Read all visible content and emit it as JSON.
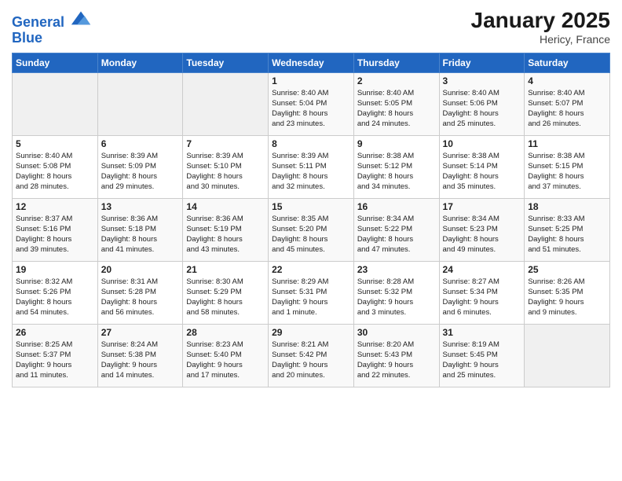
{
  "header": {
    "logo_line1": "General",
    "logo_line2": "Blue",
    "month_title": "January 2025",
    "location": "Hericy, France"
  },
  "weekdays": [
    "Sunday",
    "Monday",
    "Tuesday",
    "Wednesday",
    "Thursday",
    "Friday",
    "Saturday"
  ],
  "weeks": [
    [
      {
        "day": "",
        "info": ""
      },
      {
        "day": "",
        "info": ""
      },
      {
        "day": "",
        "info": ""
      },
      {
        "day": "1",
        "info": "Sunrise: 8:40 AM\nSunset: 5:04 PM\nDaylight: 8 hours\nand 23 minutes."
      },
      {
        "day": "2",
        "info": "Sunrise: 8:40 AM\nSunset: 5:05 PM\nDaylight: 8 hours\nand 24 minutes."
      },
      {
        "day": "3",
        "info": "Sunrise: 8:40 AM\nSunset: 5:06 PM\nDaylight: 8 hours\nand 25 minutes."
      },
      {
        "day": "4",
        "info": "Sunrise: 8:40 AM\nSunset: 5:07 PM\nDaylight: 8 hours\nand 26 minutes."
      }
    ],
    [
      {
        "day": "5",
        "info": "Sunrise: 8:40 AM\nSunset: 5:08 PM\nDaylight: 8 hours\nand 28 minutes."
      },
      {
        "day": "6",
        "info": "Sunrise: 8:39 AM\nSunset: 5:09 PM\nDaylight: 8 hours\nand 29 minutes."
      },
      {
        "day": "7",
        "info": "Sunrise: 8:39 AM\nSunset: 5:10 PM\nDaylight: 8 hours\nand 30 minutes."
      },
      {
        "day": "8",
        "info": "Sunrise: 8:39 AM\nSunset: 5:11 PM\nDaylight: 8 hours\nand 32 minutes."
      },
      {
        "day": "9",
        "info": "Sunrise: 8:38 AM\nSunset: 5:12 PM\nDaylight: 8 hours\nand 34 minutes."
      },
      {
        "day": "10",
        "info": "Sunrise: 8:38 AM\nSunset: 5:14 PM\nDaylight: 8 hours\nand 35 minutes."
      },
      {
        "day": "11",
        "info": "Sunrise: 8:38 AM\nSunset: 5:15 PM\nDaylight: 8 hours\nand 37 minutes."
      }
    ],
    [
      {
        "day": "12",
        "info": "Sunrise: 8:37 AM\nSunset: 5:16 PM\nDaylight: 8 hours\nand 39 minutes."
      },
      {
        "day": "13",
        "info": "Sunrise: 8:36 AM\nSunset: 5:18 PM\nDaylight: 8 hours\nand 41 minutes."
      },
      {
        "day": "14",
        "info": "Sunrise: 8:36 AM\nSunset: 5:19 PM\nDaylight: 8 hours\nand 43 minutes."
      },
      {
        "day": "15",
        "info": "Sunrise: 8:35 AM\nSunset: 5:20 PM\nDaylight: 8 hours\nand 45 minutes."
      },
      {
        "day": "16",
        "info": "Sunrise: 8:34 AM\nSunset: 5:22 PM\nDaylight: 8 hours\nand 47 minutes."
      },
      {
        "day": "17",
        "info": "Sunrise: 8:34 AM\nSunset: 5:23 PM\nDaylight: 8 hours\nand 49 minutes."
      },
      {
        "day": "18",
        "info": "Sunrise: 8:33 AM\nSunset: 5:25 PM\nDaylight: 8 hours\nand 51 minutes."
      }
    ],
    [
      {
        "day": "19",
        "info": "Sunrise: 8:32 AM\nSunset: 5:26 PM\nDaylight: 8 hours\nand 54 minutes."
      },
      {
        "day": "20",
        "info": "Sunrise: 8:31 AM\nSunset: 5:28 PM\nDaylight: 8 hours\nand 56 minutes."
      },
      {
        "day": "21",
        "info": "Sunrise: 8:30 AM\nSunset: 5:29 PM\nDaylight: 8 hours\nand 58 minutes."
      },
      {
        "day": "22",
        "info": "Sunrise: 8:29 AM\nSunset: 5:31 PM\nDaylight: 9 hours\nand 1 minute."
      },
      {
        "day": "23",
        "info": "Sunrise: 8:28 AM\nSunset: 5:32 PM\nDaylight: 9 hours\nand 3 minutes."
      },
      {
        "day": "24",
        "info": "Sunrise: 8:27 AM\nSunset: 5:34 PM\nDaylight: 9 hours\nand 6 minutes."
      },
      {
        "day": "25",
        "info": "Sunrise: 8:26 AM\nSunset: 5:35 PM\nDaylight: 9 hours\nand 9 minutes."
      }
    ],
    [
      {
        "day": "26",
        "info": "Sunrise: 8:25 AM\nSunset: 5:37 PM\nDaylight: 9 hours\nand 11 minutes."
      },
      {
        "day": "27",
        "info": "Sunrise: 8:24 AM\nSunset: 5:38 PM\nDaylight: 9 hours\nand 14 minutes."
      },
      {
        "day": "28",
        "info": "Sunrise: 8:23 AM\nSunset: 5:40 PM\nDaylight: 9 hours\nand 17 minutes."
      },
      {
        "day": "29",
        "info": "Sunrise: 8:21 AM\nSunset: 5:42 PM\nDaylight: 9 hours\nand 20 minutes."
      },
      {
        "day": "30",
        "info": "Sunrise: 8:20 AM\nSunset: 5:43 PM\nDaylight: 9 hours\nand 22 minutes."
      },
      {
        "day": "31",
        "info": "Sunrise: 8:19 AM\nSunset: 5:45 PM\nDaylight: 9 hours\nand 25 minutes."
      },
      {
        "day": "",
        "info": ""
      }
    ]
  ]
}
